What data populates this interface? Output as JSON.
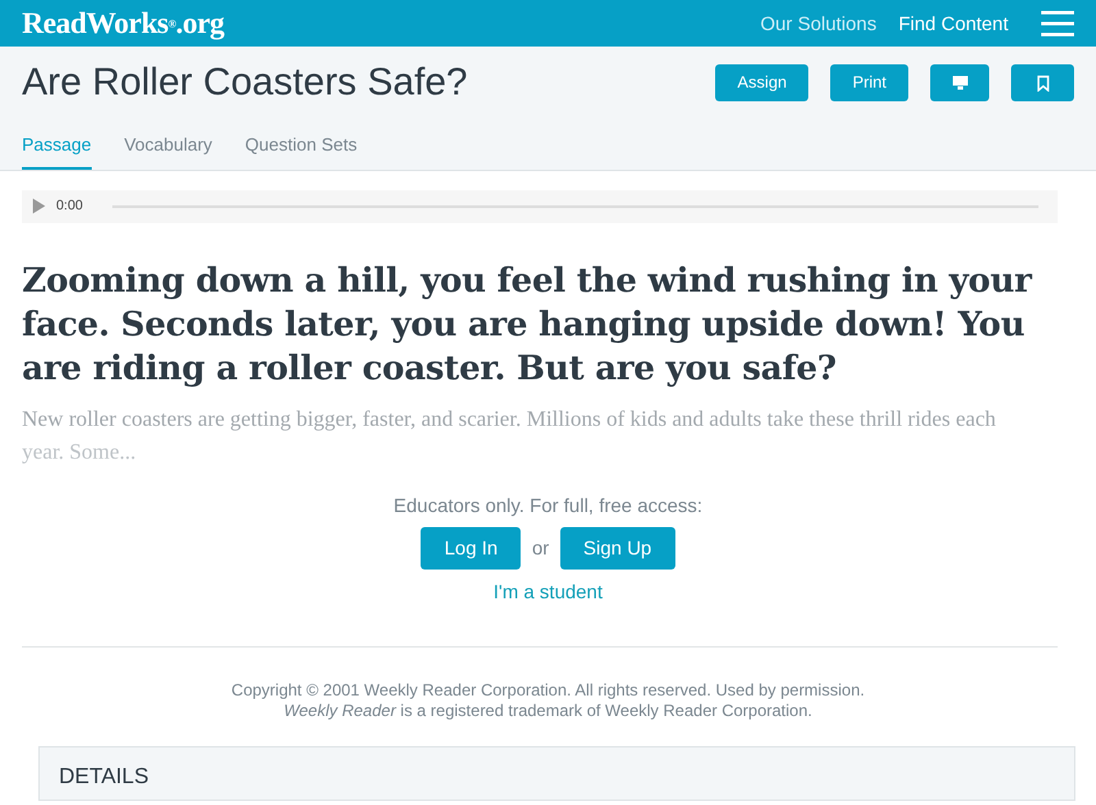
{
  "navbar": {
    "logo": "ReadWorks$^{®}$.org",
    "links": [
      {
        "label": "Our Solutions",
        "selected": false
      },
      {
        "label": "Find Content",
        "selected": true
      }
    ]
  },
  "header": {
    "title": "Are Roller Coasters Safe?",
    "buttons": [
      {
        "kind": "text",
        "label": "Assign"
      },
      {
        "kind": "text",
        "label": "Print"
      },
      {
        "kind": "monitor"
      },
      {
        "kind": "bookmark"
      }
    ],
    "tabs": [
      {
        "label": "Passage",
        "selected": true
      },
      {
        "label": "Vocabulary",
        "selected": false
      },
      {
        "label": "Question Sets",
        "selected": false
      }
    ]
  },
  "audio": {
    "time": "0:00"
  },
  "passage": {
    "headline": "Zooming down a hill, you feel the wind rushing in your face.  Seconds later, you are hanging upside down!  You are riding a roller coaster.  But are you safe?",
    "excerpt": "New roller coasters are getting bigger, faster, and scarier.  Millions of kids and adults take these thrill rides each",
    "excerpt_faded": "year.  Some..."
  },
  "access": {
    "prompt": "Educators only. For full, free access:",
    "login": "Log In",
    "separator": "or",
    "signup": "Sign Up",
    "student_link": "I'm a student"
  },
  "copyright": [
    "Copyright © 2001 Weekly Reader Corporation. All rights reserved. Used by permission.",
    "*Weekly Reader* is a registered trademark of Weekly Reader Corporation."
  ],
  "details": {
    "title": "DETAILS"
  }
}
